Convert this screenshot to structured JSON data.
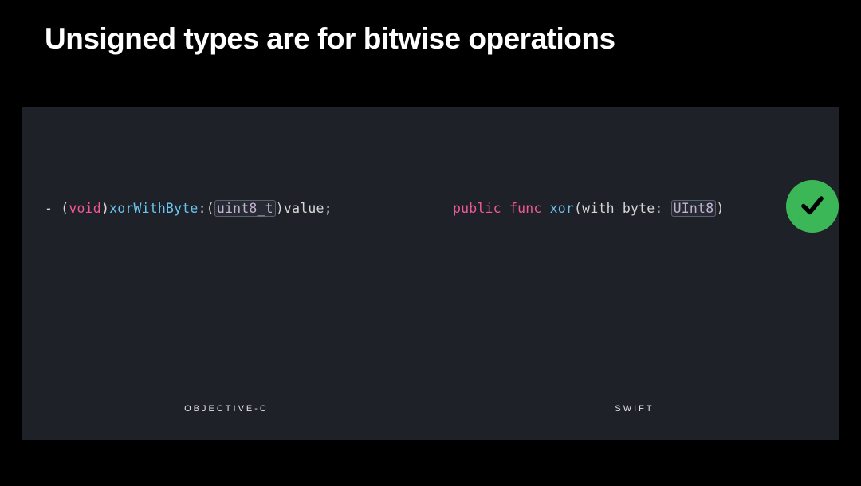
{
  "title": "Unsigned types are for bitwise operations",
  "left": {
    "langLabel": "OBJECTIVE-C",
    "code": {
      "prefix": "- (",
      "keyword": "void",
      "afterKeyword": ")",
      "method": "xorWithByte",
      "afterMethod": ":(",
      "type": "uint8_t",
      "afterType": ")value;"
    }
  },
  "right": {
    "langLabel": "SWIFT",
    "code": {
      "kw1": "public",
      "space1": " ",
      "kw2": "func",
      "space2": " ",
      "method": "xor",
      "afterMethod": "(with byte: ",
      "type": "UInt8",
      "afterType": ")"
    }
  },
  "checkmark": "check-icon"
}
